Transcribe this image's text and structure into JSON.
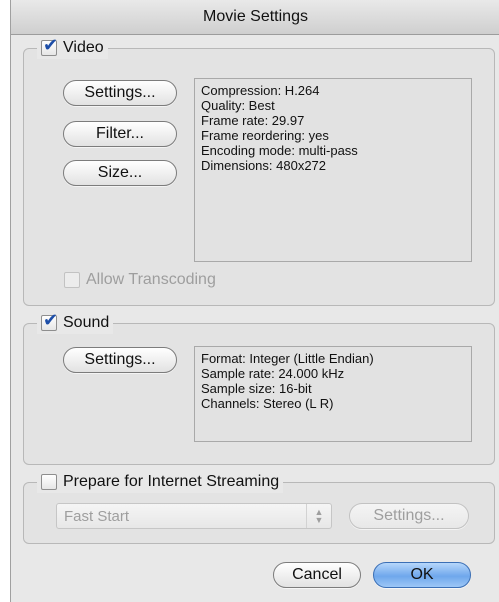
{
  "window": {
    "title": "Movie Settings"
  },
  "video": {
    "label": "Video",
    "checked": true,
    "buttons": {
      "settings": "Settings...",
      "filter": "Filter...",
      "size": "Size..."
    },
    "info": [
      "Compression: H.264",
      "Quality: Best",
      "Frame rate: 29.97",
      "Frame reordering: yes",
      "Encoding mode: multi-pass",
      "Dimensions: 480x272"
    ],
    "allow_transcoding": {
      "label": "Allow Transcoding",
      "checked": false,
      "enabled": false
    }
  },
  "sound": {
    "label": "Sound",
    "checked": true,
    "buttons": {
      "settings": "Settings..."
    },
    "info": [
      "Format: Integer (Little Endian)",
      "Sample rate: 24.000 kHz",
      "Sample size: 16-bit",
      "Channels: Stereo (L R)"
    ]
  },
  "streaming": {
    "label": "Prepare for Internet Streaming",
    "checked": false,
    "select_value": "Fast Start",
    "settings_label": "Settings..."
  },
  "footer": {
    "cancel": "Cancel",
    "ok": "OK"
  },
  "colors": {
    "default_button": "#6fa7ec",
    "checkmark": "#1d4ea8"
  }
}
